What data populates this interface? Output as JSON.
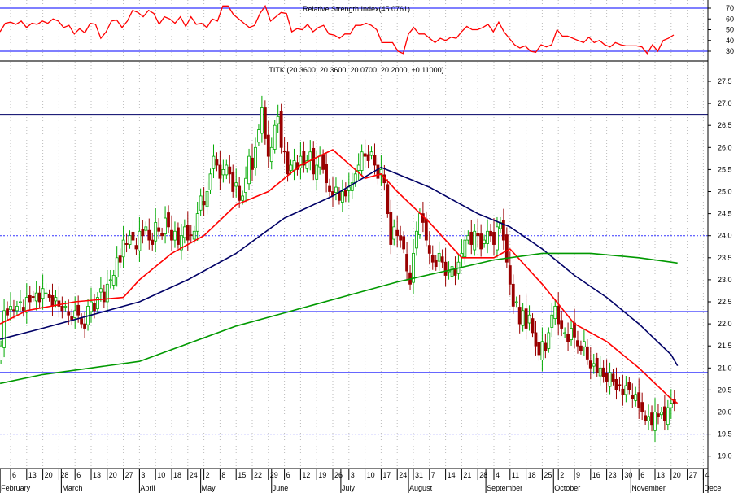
{
  "rsi_panel": {
    "title": "Relative Strength Index(45.0761)",
    "ticks": [
      70,
      60,
      50,
      40,
      30
    ],
    "range": [
      25,
      75
    ],
    "overbought": 70,
    "oversold": 30,
    "line_color": "#ff0000",
    "band_color": "#3333ff"
  },
  "price_panel": {
    "title": "TITK (20.3600, 20.3600, 20.0700, 20.2000, +0.11000)",
    "ticks": [
      "27.5",
      "27.0",
      "26.5",
      "26.0",
      "25.5",
      "25.0",
      "24.5",
      "24.0",
      "23.5",
      "23.0",
      "22.5",
      "22.0",
      "21.5",
      "21.0",
      "20.5",
      "20.0",
      "19.5",
      "19.0"
    ],
    "range": [
      18.95,
      27.8
    ],
    "levels": [
      {
        "value": 26.75,
        "style": "solid",
        "color": "#000066"
      },
      {
        "value": 24.0,
        "style": "dotted",
        "color": "#3333ff"
      },
      {
        "value": 22.28,
        "style": "solid",
        "color": "#3333ff"
      },
      {
        "value": 20.9,
        "style": "solid",
        "color": "#3333ff"
      },
      {
        "value": 19.5,
        "style": "dotted",
        "color": "#3333ff"
      }
    ]
  },
  "x_axis": {
    "day_labels": [
      "6",
      "13",
      "20",
      "28",
      "6",
      "13",
      "20",
      "27",
      "3",
      "10",
      "18",
      "24",
      "2",
      "8",
      "15",
      "22",
      "29",
      "6",
      "12",
      "19",
      "26",
      "3",
      "10",
      "17",
      "24",
      "31",
      "7",
      "14",
      "21",
      "28",
      "4",
      "11",
      "18",
      "25",
      "2",
      "9",
      "16",
      "23",
      "30",
      "6",
      "13",
      "20",
      "27",
      "4"
    ],
    "months": [
      {
        "label": "February",
        "week": -0.65
      },
      {
        "label": "March",
        "week": 3.15
      },
      {
        "label": "April",
        "week": 8
      },
      {
        "label": "May",
        "week": 11.8
      },
      {
        "label": "June",
        "week": 16.2
      },
      {
        "label": "July",
        "week": 20.5
      },
      {
        "label": "August",
        "week": 24.7
      },
      {
        "label": "September",
        "week": 29.5
      },
      {
        "label": "October",
        "week": 33.7
      },
      {
        "label": "November",
        "week": 38.5
      },
      {
        "label": "Dece",
        "week": 43
      }
    ]
  },
  "chart_data": {
    "type": "candlestick",
    "symbol": "TITK",
    "x_unit": "trading day from Feb 3 (week index: Feb 6 = 0)",
    "closes": [
      21.5,
      22.3,
      22.2,
      22.4,
      22.3,
      22.4,
      22.5,
      22.3,
      22.6,
      22.5,
      22.6,
      22.7,
      22.5,
      22.8,
      22.7,
      22.6,
      22.4,
      22.6,
      22.4,
      22.3,
      22.4,
      22.2,
      22.1,
      22.3,
      22.2,
      22.0,
      21.9,
      22.4,
      22.5,
      22.3,
      22.6,
      22.8,
      22.5,
      22.9,
      23.0,
      23.1,
      23.5,
      23.4,
      23.9,
      23.8,
      24.0,
      23.9,
      23.7,
      24.1,
      24.0,
      24.2,
      23.9,
      23.8,
      24.3,
      24.1,
      24.0,
      24.4,
      24.2,
      23.9,
      24.1,
      23.8,
      24.0,
      24.2,
      23.9,
      24.0,
      24.1,
      24.5,
      24.9,
      24.7,
      25.0,
      25.4,
      25.8,
      25.6,
      25.3,
      25.5,
      25.6,
      25.4,
      25.0,
      25.2,
      24.8,
      24.9,
      25.3,
      25.8,
      25.5,
      26.0,
      26.4,
      26.9,
      26.2,
      25.8,
      26.0,
      26.5,
      26.7,
      26.0,
      25.9,
      25.4,
      25.6,
      25.7,
      25.5,
      25.8,
      25.6,
      25.7,
      25.9,
      25.4,
      25.6,
      25.8,
      25.5,
      25.2,
      25.0,
      24.9,
      25.1,
      24.8,
      25.0,
      24.9,
      25.1,
      25.2,
      25.4,
      25.6,
      25.9,
      25.8,
      25.7,
      25.9,
      25.6,
      25.3,
      25.5,
      25.2,
      24.5,
      23.8,
      24.2,
      24.0,
      23.9,
      23.7,
      23.2,
      22.9,
      23.6,
      24.1,
      24.5,
      24.3,
      23.9,
      23.6,
      23.4,
      23.3,
      23.6,
      23.4,
      23.1,
      23.2,
      23.3,
      23.1,
      23.4,
      23.6,
      23.9,
      24.0,
      23.8,
      24.1,
      24.0,
      23.7,
      23.9,
      24.1,
      24.0,
      23.8,
      24.2,
      24.3,
      23.9,
      23.4,
      22.9,
      22.4,
      22.5,
      22.0,
      22.3,
      21.9,
      22.2,
      21.8,
      21.5,
      21.3,
      21.6,
      21.4,
      21.8,
      22.2,
      22.4,
      22.0,
      21.9,
      21.8,
      21.6,
      21.9,
      21.7,
      21.5,
      21.4,
      21.6,
      21.2,
      21.0,
      21.1,
      20.9,
      21.0,
      20.8,
      20.7,
      20.9,
      20.7,
      20.5,
      20.6,
      20.4,
      20.6,
      20.5,
      20.3,
      20.4,
      20.1,
      20.0,
      19.8,
      19.9,
      19.7,
      20.0,
      19.9,
      20.0,
      19.8,
      20.1,
      20.2,
      20.2
    ],
    "moving_averages": [
      {
        "name": "short MA",
        "color": "#ff0000",
        "points": [
          [
            -0.65,
            22.0
          ],
          [
            1,
            22.3
          ],
          [
            4,
            22.5
          ],
          [
            7,
            22.6
          ],
          [
            8,
            23.0
          ],
          [
            10,
            23.6
          ],
          [
            12,
            24.0
          ],
          [
            14,
            24.7
          ],
          [
            16,
            25.0
          ],
          [
            18,
            25.6
          ],
          [
            20,
            25.95
          ],
          [
            22,
            25.3
          ],
          [
            23,
            25.4
          ],
          [
            24,
            25.0
          ],
          [
            26,
            24.3
          ],
          [
            28,
            23.5
          ],
          [
            30,
            23.5
          ],
          [
            31,
            23.7
          ],
          [
            33,
            22.9
          ],
          [
            35,
            22.0
          ],
          [
            37,
            21.6
          ],
          [
            39,
            21.0
          ],
          [
            41,
            20.3
          ],
          [
            41.4,
            20.2
          ]
        ]
      },
      {
        "name": "medium MA",
        "color": "#000066",
        "points": [
          [
            -0.65,
            21.65
          ],
          [
            2,
            21.9
          ],
          [
            5,
            22.2
          ],
          [
            8,
            22.5
          ],
          [
            11,
            23.0
          ],
          [
            14,
            23.6
          ],
          [
            17,
            24.4
          ],
          [
            20,
            24.9
          ],
          [
            23,
            25.55
          ],
          [
            26,
            25.1
          ],
          [
            29,
            24.5
          ],
          [
            31,
            24.2
          ],
          [
            33,
            23.7
          ],
          [
            35,
            23.1
          ],
          [
            37,
            22.6
          ],
          [
            39,
            22.0
          ],
          [
            41,
            21.3
          ],
          [
            41.4,
            21.05
          ]
        ]
      },
      {
        "name": "long MA",
        "color": "#009900",
        "points": [
          [
            -0.65,
            20.65
          ],
          [
            2,
            20.85
          ],
          [
            5,
            21.0
          ],
          [
            8,
            21.15
          ],
          [
            11,
            21.55
          ],
          [
            14,
            21.95
          ],
          [
            17,
            22.25
          ],
          [
            21,
            22.65
          ],
          [
            24,
            22.95
          ],
          [
            27,
            23.2
          ],
          [
            30,
            23.45
          ],
          [
            33,
            23.6
          ],
          [
            36,
            23.6
          ],
          [
            39,
            23.5
          ],
          [
            41,
            23.4
          ],
          [
            41.4,
            23.38
          ]
        ]
      }
    ],
    "rsi": [
      48,
      56,
      57,
      55,
      58,
      52,
      56,
      55,
      58,
      56,
      60,
      58,
      52,
      54,
      46,
      51,
      47,
      56,
      55,
      42,
      48,
      58,
      59,
      52,
      58,
      68,
      66,
      62,
      68,
      65,
      55,
      62,
      60,
      56,
      62,
      53,
      62,
      55,
      56,
      52,
      60,
      58,
      72,
      72,
      64,
      60,
      56,
      52,
      54,
      65,
      72,
      58,
      62,
      66,
      65,
      48,
      51,
      50,
      55,
      48,
      52,
      54,
      46,
      45,
      42,
      46,
      46,
      54,
      54,
      56,
      54,
      50,
      38,
      38,
      38,
      30,
      28,
      46,
      52,
      46,
      46,
      42,
      38,
      42,
      40,
      43,
      42,
      48,
      53,
      50,
      50,
      52,
      55,
      48,
      57,
      48,
      42,
      36,
      33,
      35,
      30,
      29,
      36,
      34,
      36,
      50,
      44,
      44,
      42,
      40,
      38,
      43,
      38,
      40,
      36,
      34,
      38,
      36,
      35,
      35,
      35,
      34,
      28,
      36,
      30,
      40,
      42,
      45.08
    ],
    "up_color": "#00aa00",
    "down_color": "#990000"
  }
}
